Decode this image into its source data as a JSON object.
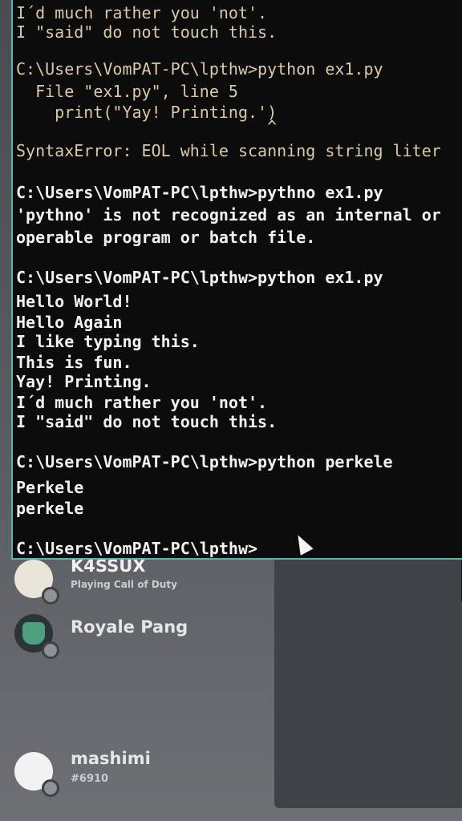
{
  "console": {
    "lines": [
      "I´d much rather you 'not'.",
      "I \"said\" do not touch this.",
      "",
      "C:\\Users\\VomPAT-PC\\lpthw>python ex1.py",
      "  File \"ex1.py\", line 5",
      "    print(\"Yay! Printing.')",
      "                          ^",
      "SyntaxError: EOL while scanning string liter",
      "",
      "C:\\Users\\VomPAT-PC\\lpthw>pythno ex1.py",
      "'pythno' is not recognized as an internal or",
      "operable program or batch file.",
      "",
      "C:\\Users\\VomPAT-PC\\lpthw>python ex1.py",
      "Hello World!",
      "Hello Again",
      "I like typing this.",
      "This is fun.",
      "Yay! Printing.",
      "I´d much rather you 'not'.",
      "I \"said\" do not touch this.",
      "",
      "C:\\Users\\VomPAT-PC\\lpthw>python perkele",
      "Perkele",
      "perkele",
      "",
      "C:\\Users\\VomPAT-PC\\lpthw>"
    ]
  },
  "discord": {
    "members": [
      {
        "name": "K4SSUX",
        "activity": "Playing Call of Duty"
      },
      {
        "name": "Royale Pang",
        "activity": ""
      },
      {
        "name": "mashimi",
        "activity": "#6910"
      }
    ]
  },
  "colors": {
    "console_bg": "#0c0c0c",
    "console_border": "#5ab3b0",
    "console_text": "#f2f2f2",
    "discord_bg": "#3f4247"
  },
  "icons": {
    "cursor": "mouse-pointer-icon",
    "avatar_status": "status-dot-icon"
  }
}
